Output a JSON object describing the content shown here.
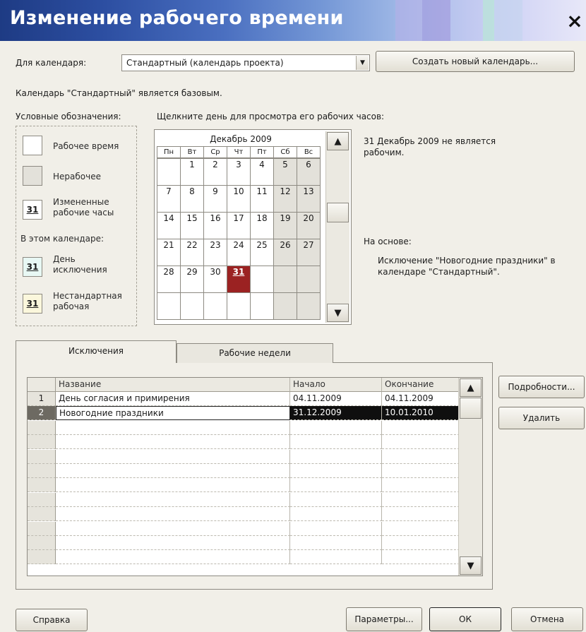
{
  "window": {
    "title": "Изменение рабочего времени",
    "close_glyph": "×"
  },
  "calendar_select": {
    "label": "Для календаря:",
    "value": "Стандартный (календарь проекта)",
    "create_button": "Создать новый календарь..."
  },
  "base_info": "Календарь \"Стандартный\" является базовым.",
  "legend": {
    "title": "Условные обозначения:",
    "working": "Рабочее время",
    "nonworking": "Нерабочее",
    "changed_label": "Измененные рабочие часы",
    "changed_num": "31",
    "in_calendar": "В этом календаре:",
    "exception_label": "День исключения",
    "exception_num": "31",
    "nonstandard_label": "Нестандартная рабочая",
    "nonstandard_num": "31"
  },
  "calendar": {
    "hint": "Щелкните день для просмотра его рабочих часов:",
    "month": "Декабрь 2009",
    "weekdays": [
      "Пн",
      "Вт",
      "Ср",
      "Чт",
      "Пт",
      "Сб",
      "Вс"
    ],
    "weeks": [
      [
        "",
        "1",
        "2",
        "3",
        "4",
        "5",
        "6"
      ],
      [
        "7",
        "8",
        "9",
        "10",
        "11",
        "12",
        "13"
      ],
      [
        "14",
        "15",
        "16",
        "17",
        "18",
        "19",
        "20"
      ],
      [
        "21",
        "22",
        "23",
        "24",
        "25",
        "26",
        "27"
      ],
      [
        "28",
        "29",
        "30",
        "31",
        "",
        "",
        ""
      ],
      [
        "",
        "",
        "",
        "",
        "",
        "",
        ""
      ]
    ],
    "selected_day": "31",
    "scroll_up": "▲",
    "scroll_down": "▼"
  },
  "day_info": {
    "status": "31 Декабрь 2009 не является рабочим.",
    "based_on_label": "На основе:",
    "based_on_text": "Исключение \"Новогодние праздники\" в календаре \"Стандартный\"."
  },
  "tabs": [
    {
      "label": "Исключения",
      "active": true
    },
    {
      "label": "Рабочие недели",
      "active": false
    }
  ],
  "exceptions_table": {
    "columns": [
      "",
      "Название",
      "Начало",
      "Окончание"
    ],
    "rows": [
      {
        "num": "1",
        "name": "День согласия и примирения",
        "start": "04.11.2009",
        "end": "04.11.2009"
      },
      {
        "num": "2",
        "name": "Новогодние праздники",
        "start": "31.12.2009",
        "end": "10.01.2010"
      }
    ],
    "empty_rows": 10,
    "scroll_up": "▲",
    "scroll_down": "▼"
  },
  "side_buttons": {
    "details": "Подробности...",
    "delete": "Удалить"
  },
  "footer": {
    "help": "Справка",
    "params": "Параметры...",
    "ok": "ОК",
    "cancel": "Отмена"
  },
  "colors": {
    "title_gradient_start": "#1e3b84",
    "selected_day": "#9b2222",
    "dialog_bg": "#f1efe8"
  }
}
